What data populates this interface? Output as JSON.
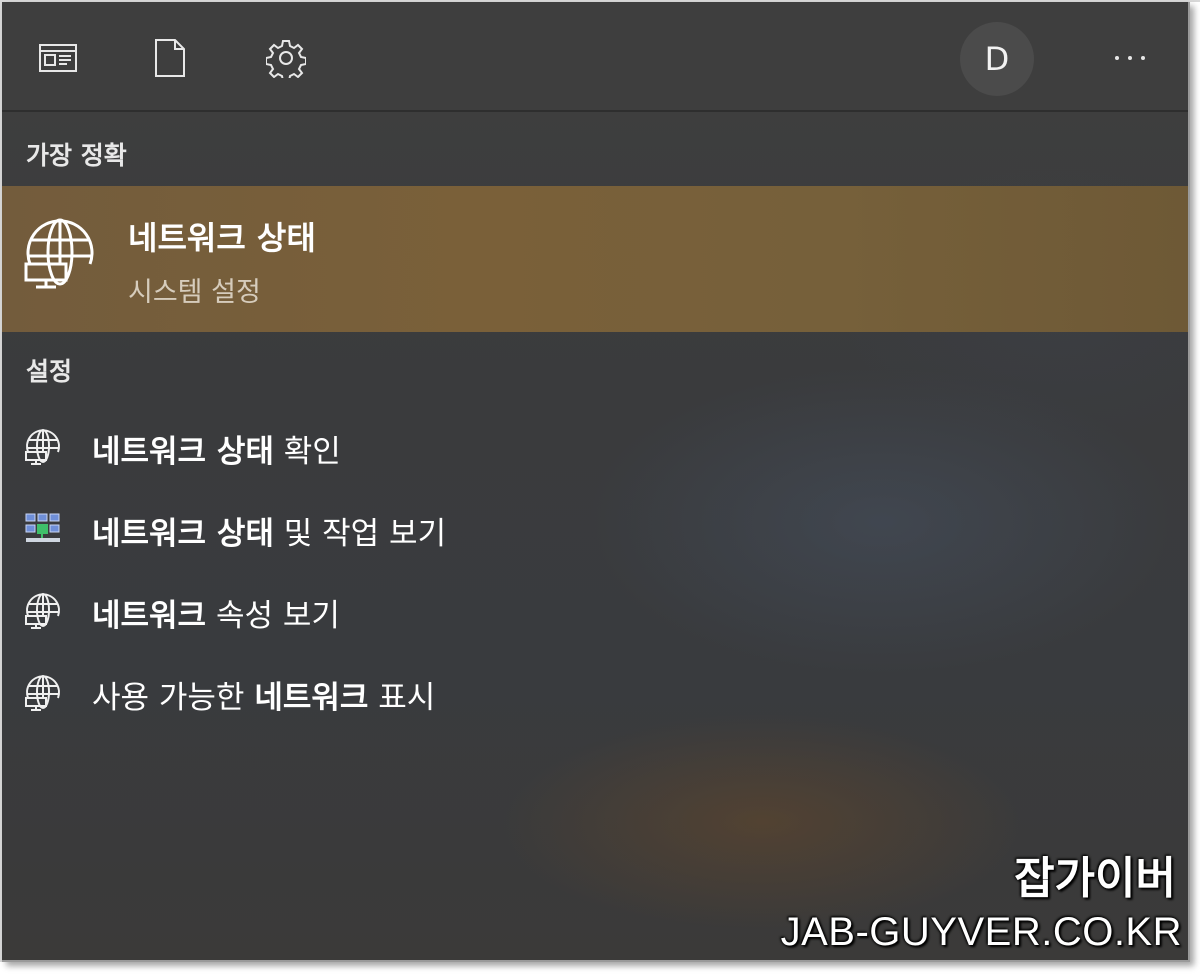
{
  "toolbar": {
    "icons": [
      "news-icon",
      "document-icon",
      "settings-gear-icon"
    ],
    "avatar_initial": "D",
    "more_icon": "more-ellipsis-icon"
  },
  "best_match": {
    "section_label": "가장 정확",
    "title": "네트워크 상태",
    "subtitle": "시스템 설정",
    "icon": "network-globe-icon",
    "highlight_color": "#76603a"
  },
  "settings": {
    "section_label": "설정",
    "items": [
      {
        "icon": "network-globe-icon",
        "bold": "네트워크 상태",
        "rest": " 확인"
      },
      {
        "icon": "network-control-panel-icon",
        "bold": "네트워크 상태",
        "rest": " 및 작업 보기"
      },
      {
        "icon": "network-globe-icon",
        "bold": "네트워크",
        "rest": " 속성 보기"
      },
      {
        "icon": "network-globe-icon",
        "prefix": "사용 가능한 ",
        "bold": "네트워크",
        "rest": " 표시"
      }
    ]
  },
  "watermark": {
    "name": "잡가이버",
    "url": "JAB-GUYVER.CO.KR"
  }
}
